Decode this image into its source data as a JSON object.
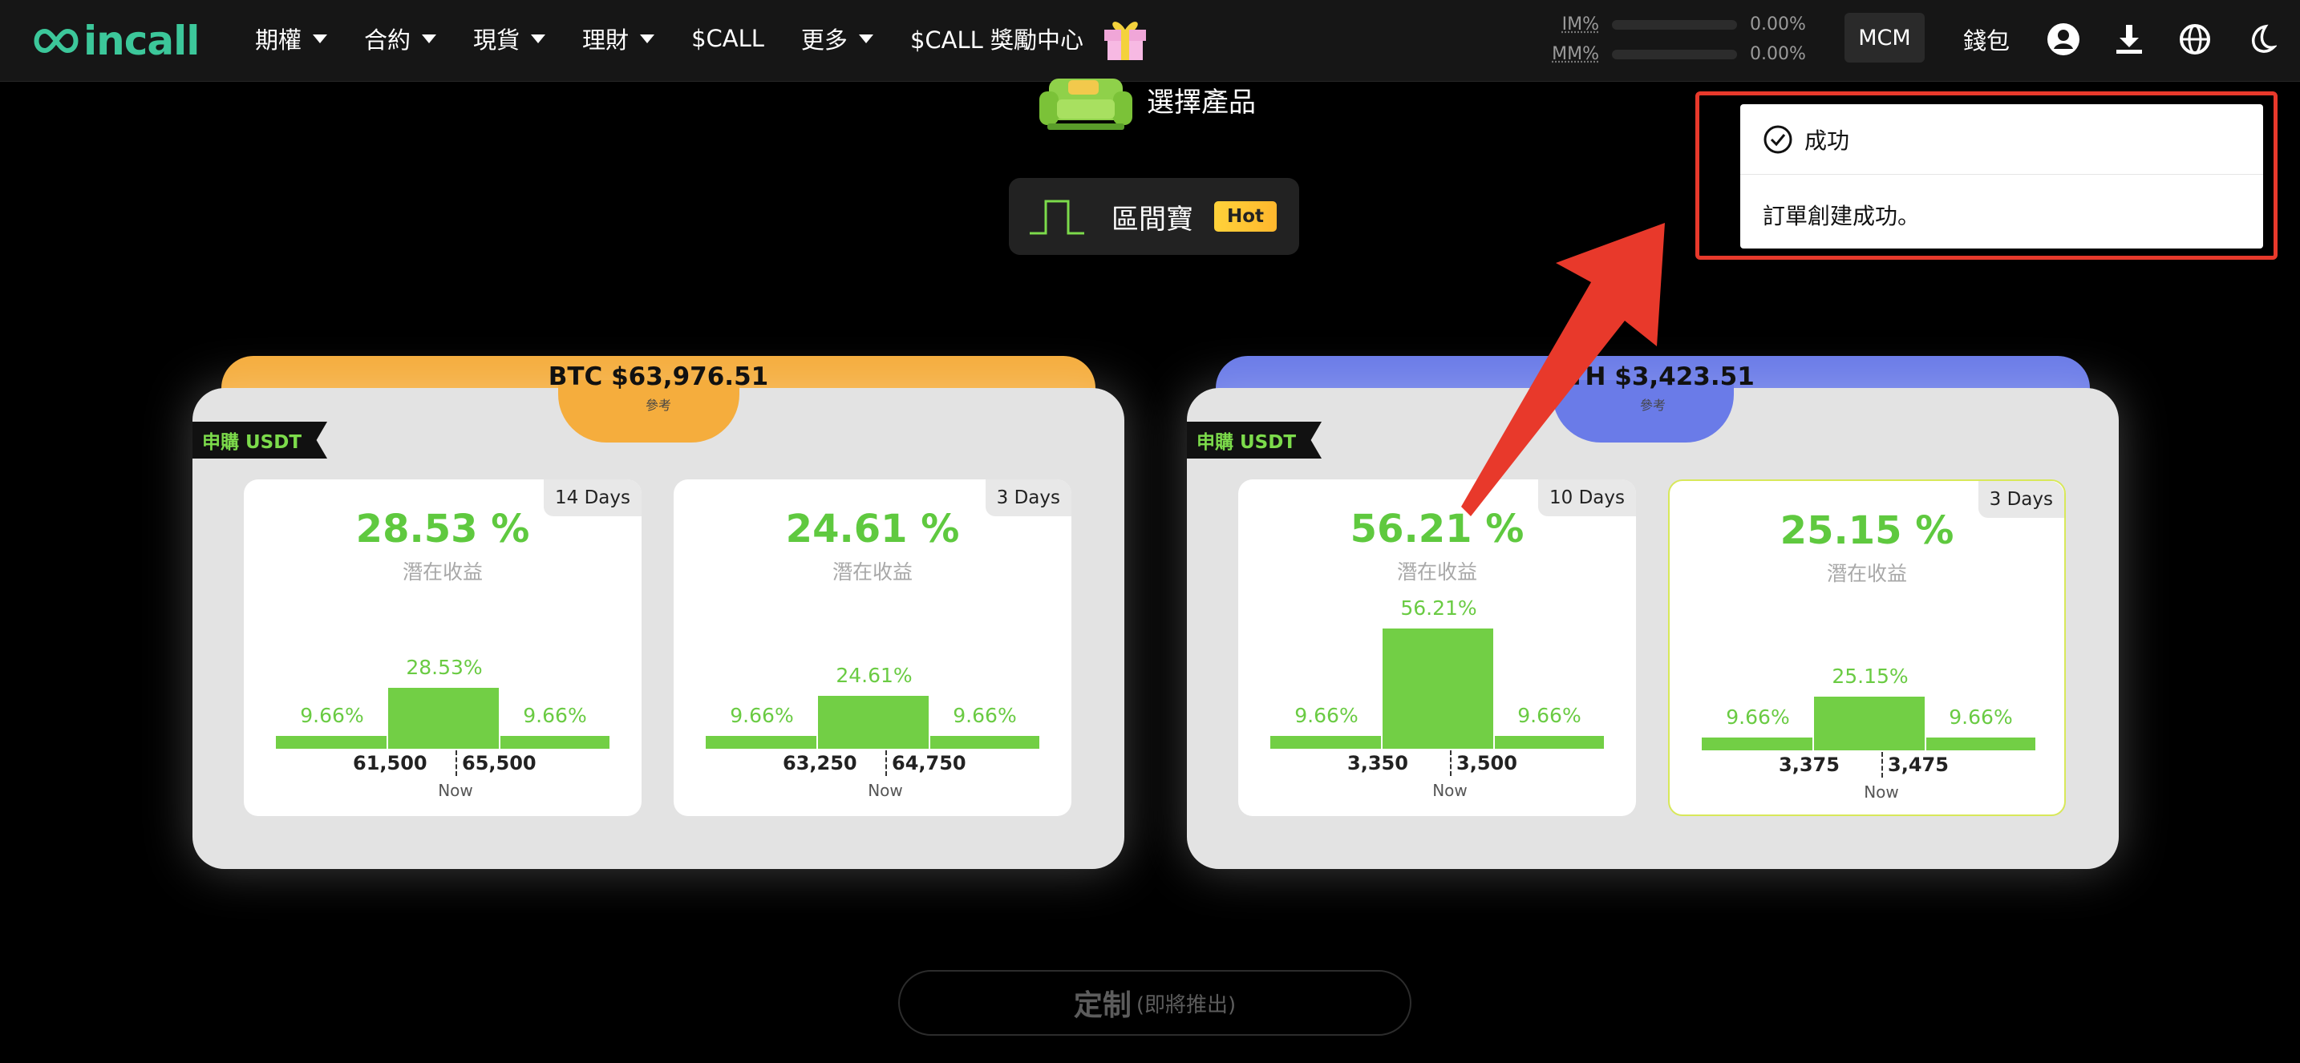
{
  "nav": {
    "logo_text": "incall",
    "menu": [
      {
        "label": "期權",
        "caret": true
      },
      {
        "label": "合約",
        "caret": true
      },
      {
        "label": "現貨",
        "caret": true
      },
      {
        "label": "理財",
        "caret": true
      },
      {
        "label": "$CALL",
        "caret": false
      },
      {
        "label": "更多",
        "caret": true
      },
      {
        "label": "$CALL 獎勵中心",
        "caret": false
      }
    ],
    "im_label": "IM%",
    "im_value": "0.00%",
    "mm_label": "MM%",
    "mm_value": "0.00%",
    "account_button": "MCM",
    "wallet": "錢包",
    "icons": [
      "account-icon",
      "download-icon",
      "globe-icon",
      "moon-icon"
    ]
  },
  "product": {
    "choose_label": "選擇產品",
    "range_label": "區間寶",
    "hot_badge": "Hot"
  },
  "panels": [
    {
      "id": "btc",
      "price_label": "BTC $63,976.51",
      "ref_label": "參考",
      "subscribe_label": "申購 USDT",
      "accent": "#f5ad3d",
      "cards": [
        {
          "days": "14 Days",
          "pct": "28.53 %",
          "sub": "潛在收益",
          "side_left": "9.66%",
          "center": "28.53%",
          "side_right": "9.66%",
          "center_fraction": 0.2853,
          "low": "61,500",
          "high": "65,500",
          "now": "Now",
          "selected": false
        },
        {
          "days": "3 Days",
          "pct": "24.61 %",
          "sub": "潛在收益",
          "side_left": "9.66%",
          "center": "24.61%",
          "side_right": "9.66%",
          "center_fraction": 0.2461,
          "low": "63,250",
          "high": "64,750",
          "now": "Now",
          "selected": false
        }
      ]
    },
    {
      "id": "eth",
      "price_label": "ETH $3,423.51",
      "ref_label": "參考",
      "subscribe_label": "申購 USDT",
      "accent": "#6a7be8",
      "cards": [
        {
          "days": "10 Days",
          "pct": "56.21 %",
          "sub": "潛在收益",
          "side_left": "9.66%",
          "center": "56.21%",
          "side_right": "9.66%",
          "center_fraction": 0.5621,
          "low": "3,350",
          "high": "3,500",
          "now": "Now",
          "selected": false
        },
        {
          "days": "3 Days",
          "pct": "25.15 %",
          "sub": "潛在收益",
          "side_left": "9.66%",
          "center": "25.15%",
          "side_right": "9.66%",
          "center_fraction": 0.2515,
          "low": "3,375",
          "high": "3,475",
          "now": "Now",
          "selected": true
        }
      ]
    }
  ],
  "custom_button": {
    "main": "定制",
    "sub": "(即將推出)"
  },
  "toast": {
    "title": "成功",
    "message": "訂單創建成功。"
  },
  "colors": {
    "green": "#72cf45",
    "brand": "#3cc79a",
    "highlight": "#e8392b"
  }
}
